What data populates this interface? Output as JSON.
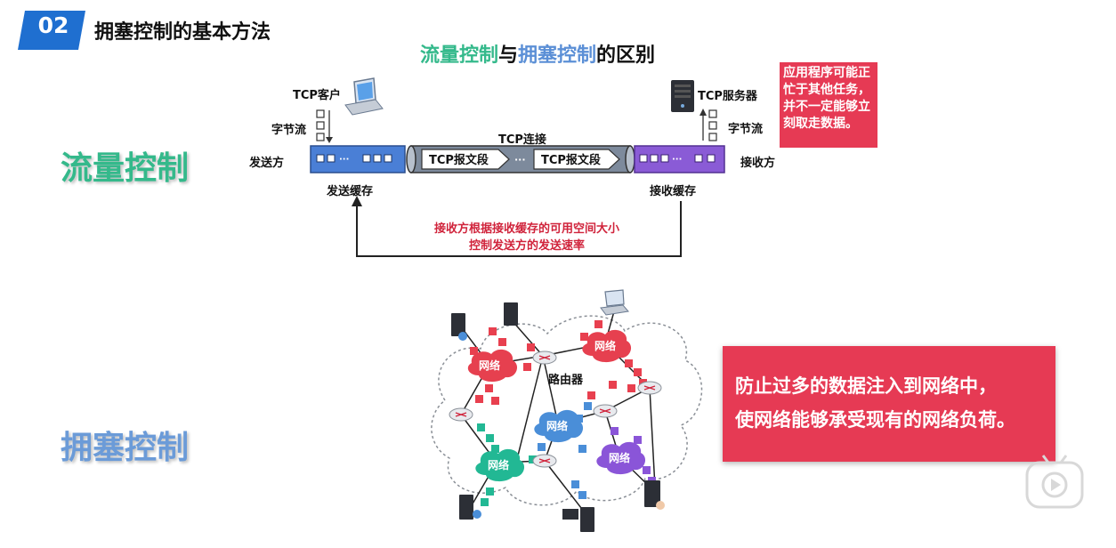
{
  "header": {
    "badge": "02",
    "title": "拥塞控制的基本方法"
  },
  "comparison_title": {
    "part1": "流量控制",
    "part2": "与",
    "part3": "拥塞控制",
    "part4": "的区别"
  },
  "flow": {
    "label": "流量控制",
    "tcp_client": "TCP客户",
    "tcp_server": "TCP服务器",
    "byte_stream": "字节流",
    "sender": "发送方",
    "receiver": "接收方",
    "send_buffer": "发送缓存",
    "recv_buffer": "接收缓存",
    "tcp_connection": "TCP连接",
    "segment": "TCP报文段",
    "ellipsis": "···",
    "app_note": "应用程序可能正忙于其他任务，并不一定能够立刻取走数据。",
    "control_line1": "接收方根据接收缓存的可用空间大小",
    "control_line2": "控制发送方的发送速率"
  },
  "congestion": {
    "label": "拥塞控制",
    "network": "网络",
    "router": "路由器",
    "note_line1": "防止过多的数据注入到网络中，",
    "note_line2": "使网络能够承受现有的网络负荷。"
  },
  "colors": {
    "badge": "#1f6fd0",
    "flow_green": "#34b98b",
    "congestion_blue": "#6b9bd8",
    "alert_red": "#e63a54",
    "send_buffer": "#4a7fd6",
    "recv_buffer": "#8a5bd6"
  }
}
